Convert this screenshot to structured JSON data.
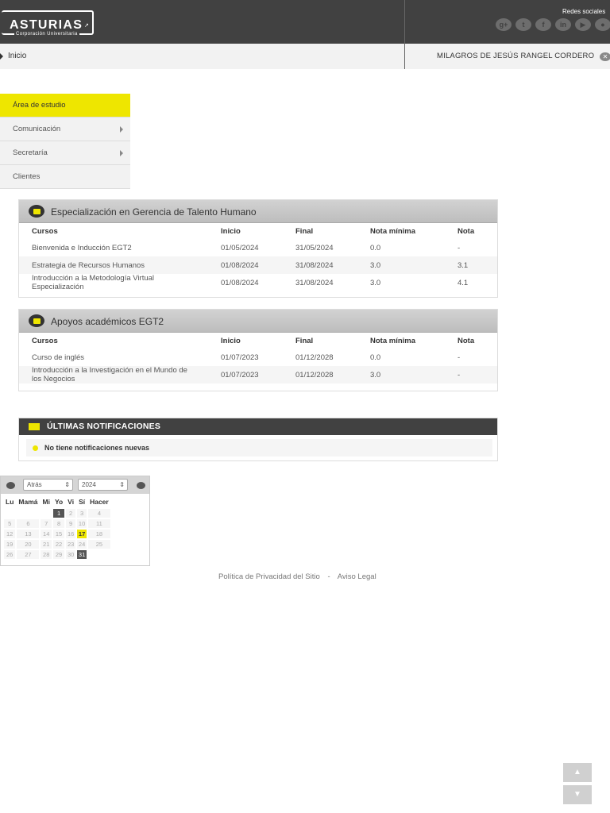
{
  "header": {
    "logo_main": "ASTURIAS",
    "logo_sub": "Corporación Universitaria",
    "social_label": "Redes sociales",
    "social_icons": [
      "google-plus-icon",
      "twitter-icon",
      "facebook-icon",
      "linkedin-icon",
      "youtube-icon",
      "chat-icon"
    ]
  },
  "subbar": {
    "home": "Inicio",
    "user": "MILAGROS DE JESÚS RANGEL CORDERO"
  },
  "sidebar": {
    "items": [
      {
        "label": "Área de estudio",
        "active": true
      },
      {
        "label": "Comunicación",
        "submenu": true
      },
      {
        "label": "Secretaría",
        "submenu": true
      },
      {
        "label": "Clientes"
      }
    ]
  },
  "columns": {
    "courses": "Cursos",
    "start": "Inicio",
    "end": "Final",
    "min_grade": "Nota mínima",
    "grade": "Nota"
  },
  "programs": [
    {
      "title": "Especialización en Gerencia de Talento Humano",
      "rows": [
        {
          "course": "Bienvenida e Inducción EGT2",
          "start": "01/05/2024",
          "end": "31/05/2024",
          "min": "0.0",
          "grade": "-"
        },
        {
          "course": "Estrategia de Recursos Humanos",
          "start": "01/08/2024",
          "end": "31/08/2024",
          "min": "3.0",
          "grade": "3.1"
        },
        {
          "course_l1": "Introducción a la Metodología Virtual",
          "course_l2": "Especialización",
          "start": "01/08/2024",
          "end": "31/08/2024",
          "min": "3.0",
          "grade": "4.1"
        }
      ]
    },
    {
      "title": "Apoyos académicos EGT2",
      "rows": [
        {
          "course": "Curso de inglés",
          "start": "01/07/2023",
          "end": "01/12/2028",
          "min": "0.0",
          "grade": "-"
        },
        {
          "course_l1": "Introducción a la Investigación en el Mundo de",
          "course_l2": "los Negocios",
          "start": "01/07/2023",
          "end": "01/12/2028",
          "min": "3.0",
          "grade": "-"
        }
      ]
    }
  ],
  "notifications": {
    "title": "ÚLTIMAS NOTIFICACIONES",
    "empty": "No tiene notificaciones nuevas"
  },
  "calendar": {
    "month": "Atrás",
    "year": "2024",
    "weekdays": [
      "Lu",
      "Mamá",
      "Mi",
      "Yo",
      "Vi",
      "Sí",
      "Hacer"
    ],
    "weeks": [
      [
        "",
        "",
        "",
        "1",
        "2",
        "3",
        "4"
      ],
      [
        "5",
        "6",
        "7",
        "8",
        "9",
        "10",
        "11"
      ],
      [
        "12",
        "13",
        "14",
        "15",
        "16",
        "17",
        "18"
      ],
      [
        "19",
        "20",
        "21",
        "22",
        "23",
        "24",
        "25"
      ],
      [
        "26",
        "27",
        "28",
        "29",
        "30",
        "31",
        ""
      ]
    ],
    "highlighted_dark": [
      "1",
      "31"
    ],
    "today": "17"
  },
  "footer": {
    "privacy": "Política de Privacidad del Sitio",
    "separator": "-",
    "legal": "Aviso Legal"
  },
  "scroll": {
    "up": "▲",
    "down": "▼"
  }
}
